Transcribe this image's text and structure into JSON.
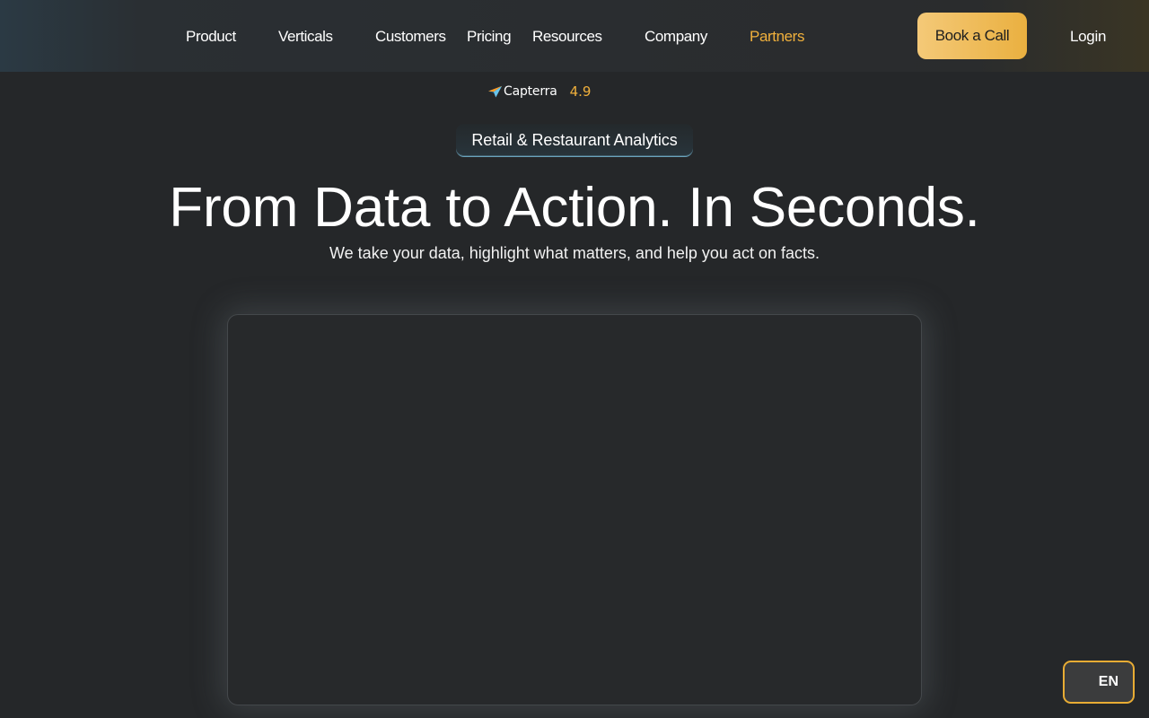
{
  "nav": {
    "items": [
      {
        "label": "Product"
      },
      {
        "label": "Verticals"
      },
      {
        "label": "Customers"
      },
      {
        "label": "Pricing"
      },
      {
        "label": "Resources"
      },
      {
        "label": "Company"
      },
      {
        "label": "Partners"
      }
    ],
    "cta_label": "Book a Call",
    "login_label": "Login",
    "accent_color": "#f0b03c"
  },
  "rating": {
    "brand": "Capterra",
    "score": "4.9",
    "logo_icon": "capterra-arrow-icon"
  },
  "hero": {
    "pill": "Retail & Restaurant Analytics",
    "title": "From Data to Action. In Seconds.",
    "subtitle": "We take your data, highlight what matters, and help you act on facts."
  },
  "language": {
    "current": "EN"
  }
}
